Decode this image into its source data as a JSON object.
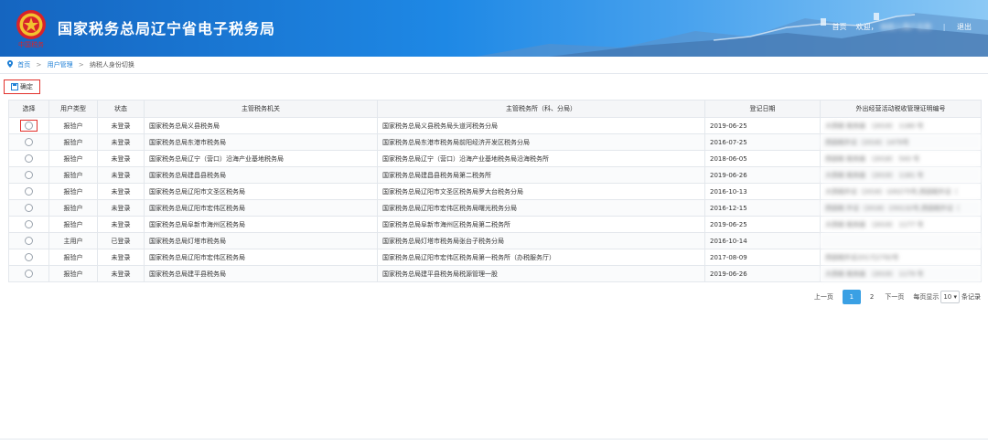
{
  "header": {
    "title": "国家税务总局辽宁省电子税务局",
    "emblem_text": "中国税务",
    "home_link": "首页",
    "greeting": "欢迎，",
    "user_name": "纳税人用户名称",
    "logout": "退出"
  },
  "breadcrumb": {
    "items": [
      "首页",
      "用户管理",
      "纳税人身份切换"
    ]
  },
  "toolbar": {
    "confirm_label": "确定"
  },
  "table": {
    "headers": [
      "选择",
      "用户类型",
      "状态",
      "主管税务机关",
      "主管税务所（科、分局）",
      "登记日期",
      "外出经营活动税收管理证明编号"
    ],
    "rows": [
      {
        "type": "报验户",
        "status": "未登录",
        "office": "国家税务总局义县税务局",
        "branch": "国家税务总局义县税务局头道河税务分局",
        "date": "2019-06-25",
        "cert": "大西税 税务报 〔2019〕 1180 号"
      },
      {
        "type": "报验户",
        "status": "未登录",
        "office": "国家税务总局东港市税务局",
        "branch": "国家税务总局东港市税务局前阳经济开发区税务分局",
        "date": "2016-07-25",
        "cert": "西固税外证〔2016〕1479号"
      },
      {
        "type": "报验户",
        "status": "未登录",
        "office": "国家税务总局辽宁（营口）沿海产业基地税务局",
        "branch": "国家税务总局辽宁（营口）沿海产业基地税务局沿海税务所",
        "date": "2018-06-05",
        "cert": "西固税 税务报 〔2018〕 543 号"
      },
      {
        "type": "报验户",
        "status": "未登录",
        "office": "国家税务总局建昌县税务局",
        "branch": "国家税务总局建昌县税务局第二税务所",
        "date": "2019-06-26",
        "cert": "大西税 税务报 〔2019〕 1181 号"
      },
      {
        "type": "报验户",
        "status": "未登录",
        "office": "国家税务总局辽阳市文圣区税务局",
        "branch": "国家税务总局辽阳市文圣区税务局罗大台税务分局",
        "date": "2016-10-13",
        "cert": "大西税外证〔2016〕100275号,西固税外证〔"
      },
      {
        "type": "报验户",
        "status": "未登录",
        "office": "国家税务总局辽阳市宏伟区税务局",
        "branch": "国家税务总局辽阳市宏伟区税务局曙光税务分局",
        "date": "2016-12-15",
        "cert": "西固税 外证〔2016〕150132号,西固税外证〔"
      },
      {
        "type": "报验户",
        "status": "未登录",
        "office": "国家税务总局阜新市海州区税务局",
        "branch": "国家税务总局阜新市海州区税务局第二税务所",
        "date": "2019-06-25",
        "cert": "大西税 税务报 〔2019〕 1177 号"
      },
      {
        "type": "主用户",
        "status": "已登录",
        "office": "国家税务总局灯塔市税务局",
        "branch": "国家税务总局灯塔市税务局张台子税务分局",
        "date": "2016-10-14",
        "cert": ""
      },
      {
        "type": "报验户",
        "status": "未登录",
        "office": "国家税务总局辽阳市宏伟区税务局",
        "branch": "国家税务总局辽阳市宏伟区税务局第一税务所（办税服务厅）",
        "date": "2017-08-09",
        "cert": "西固税外证2017[2792号"
      },
      {
        "type": "报验户",
        "status": "未登录",
        "office": "国家税务总局建平县税务局",
        "branch": "国家税务总局建平县税务局税源管理一股",
        "date": "2019-06-26",
        "cert": "大西税 税务报 〔2019〕 1179 号"
      }
    ]
  },
  "pager": {
    "prev": "上一页",
    "pages": [
      "1",
      "2"
    ],
    "next": "下一页",
    "per_page_prefix": "每页显示",
    "per_page_value": "10",
    "per_page_suffix": "条记录"
  },
  "colors": {
    "header_blue": "#1565c0",
    "accent": "#3aa0e4",
    "highlight_red": "#e2302b"
  }
}
